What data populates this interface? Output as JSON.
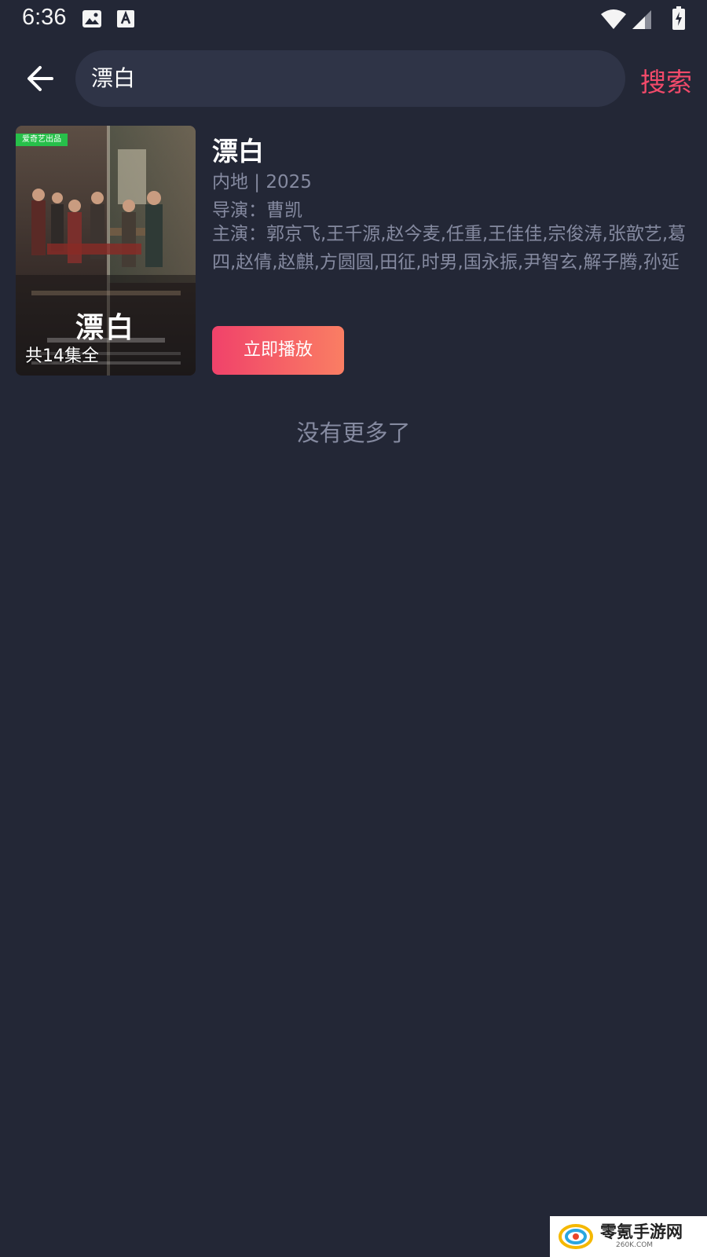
{
  "status_bar": {
    "time": "6:36",
    "icons": [
      "image-icon",
      "text-icon",
      "wifi-icon",
      "signal-icon",
      "battery-icon"
    ]
  },
  "header": {
    "back_icon": "arrow-left-icon",
    "search_value": "漂白",
    "search_button": "搜索"
  },
  "result": {
    "poster_badge": "爱奇艺出品",
    "poster_title": "漂白",
    "episodes": "共14集全",
    "title": "漂白",
    "region_year": "内地 | 2025",
    "director": "导演：曹凯",
    "cast": "主演：郭京飞,王千源,赵今麦,任重,王佳佳,宗俊涛,张歆艺,葛四,赵倩,赵麒,方圆圆,田征,时男,国永振,尹智玄,解子腾,孙延",
    "play_button": "立即播放"
  },
  "footer_text": "没有更多了",
  "watermark": {
    "text": "零氪手游网",
    "sub": "260K.COM"
  },
  "colors": {
    "background": "#232736",
    "search_box": "#2f3447",
    "accent": "#f24a6a",
    "button_start": "#f0426a",
    "button_end": "#fa7e63",
    "muted_text": "#858aa0"
  }
}
